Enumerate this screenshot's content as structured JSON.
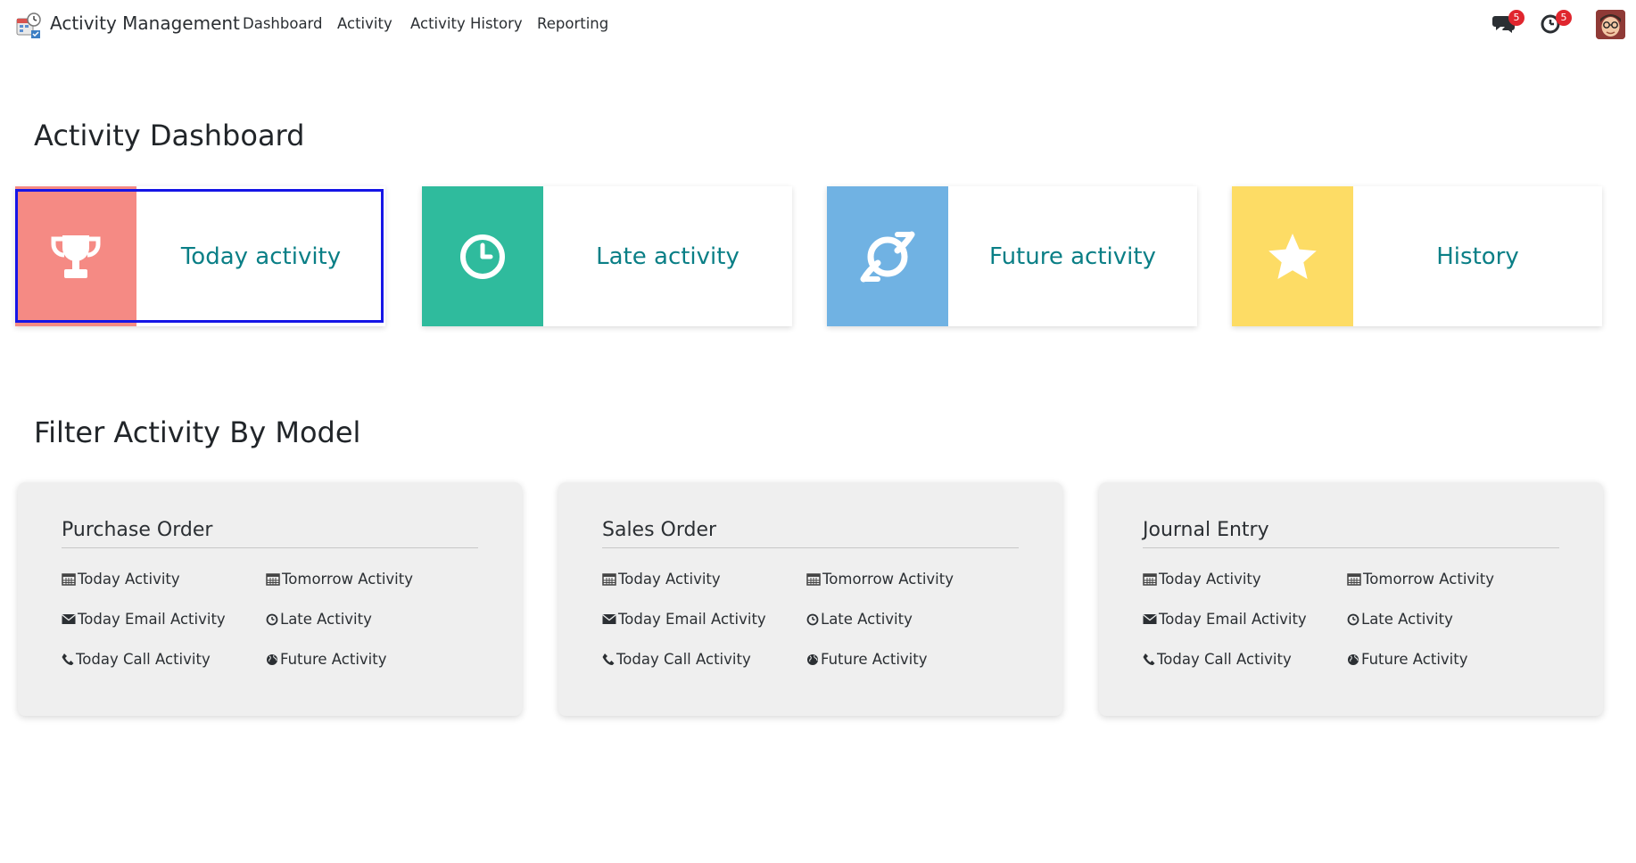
{
  "app": {
    "title": "Activity Management"
  },
  "nav": {
    "items": [
      "Dashboard",
      "Activity",
      "Activity History",
      "Reporting"
    ]
  },
  "systray": {
    "messages_count": "5",
    "activities_count": "5"
  },
  "dashboard": {
    "heading": "Activity Dashboard",
    "tiles": [
      {
        "label": "Today activity",
        "color": "#f58a84",
        "icon": "trophy-icon"
      },
      {
        "label": "Late activity",
        "color": "#2fbb9d",
        "icon": "clock-icon"
      },
      {
        "label": "Future activity",
        "color": "#70b2e3",
        "icon": "saturn-icon"
      },
      {
        "label": "History",
        "color": "#fddc65",
        "icon": "star-icon"
      }
    ],
    "label_color": "#0a7f86"
  },
  "filter": {
    "heading": "Filter Activity By Model",
    "cards": [
      {
        "title": "Purchase Order",
        "links": [
          "Today Activity",
          "Tomorrow Activity",
          "Today Email Activity",
          "Late Activity",
          "Today Call Activity",
          "Future Activity"
        ]
      },
      {
        "title": "Sales Order",
        "links": [
          "Today Activity",
          "Tomorrow Activity",
          "Today Email Activity",
          "Late Activity",
          "Today Call Activity",
          "Future Activity"
        ]
      },
      {
        "title": "Journal Entry",
        "links": [
          "Today Activity",
          "Tomorrow Activity",
          "Today Email Activity",
          "Late Activity",
          "Today Call Activity",
          "Future Activity"
        ]
      }
    ]
  }
}
